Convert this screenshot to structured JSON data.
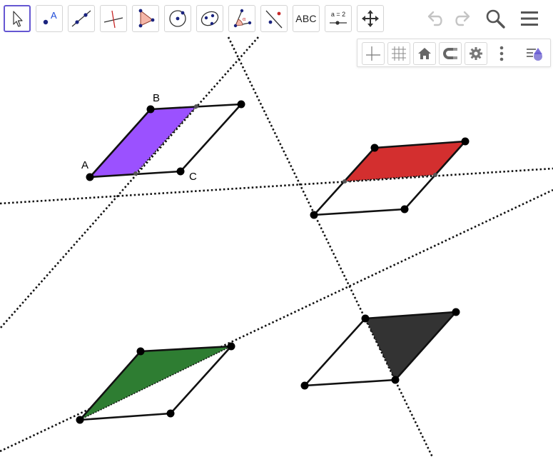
{
  "toolbar": {
    "tools": [
      {
        "name": "Move",
        "icon": "arrow-cursor-icon",
        "selected": true
      },
      {
        "name": "Point",
        "icon": "point-icon"
      },
      {
        "name": "Line",
        "icon": "line-icon"
      },
      {
        "name": "Perpendicular Line",
        "icon": "perpendicular-line-icon"
      },
      {
        "name": "Polygon",
        "icon": "polygon-icon"
      },
      {
        "name": "Circle with Center",
        "icon": "circle-center-icon"
      },
      {
        "name": "Ellipse",
        "icon": "ellipse-icon"
      },
      {
        "name": "Angle",
        "icon": "angle-icon"
      },
      {
        "name": "Reflect about Line",
        "icon": "reflect-line-icon"
      },
      {
        "name": "Text",
        "icon": "text-tool-icon",
        "label": "ABC"
      },
      {
        "name": "Slider",
        "icon": "slider-icon",
        "label": "a = 2"
      },
      {
        "name": "Move Graphics View",
        "icon": "move-view-icon"
      }
    ],
    "right": [
      "undo-icon",
      "redo-icon",
      "search-icon",
      "menu-icon"
    ]
  },
  "style_bar": {
    "buttons": [
      "axes-icon",
      "grid-icon",
      "home-icon",
      "snap-icon",
      "settings-icon",
      "more-icon"
    ],
    "toggle": "view-toggle-icon"
  },
  "canvas": {
    "point_labels": {
      "A": "A",
      "B": "B",
      "C": "C"
    },
    "colors": {
      "purple": "#9b51ff",
      "red": "#d32f2f",
      "green": "#2e7d32",
      "dark": "#333333",
      "accent": "#6557d2"
    }
  }
}
